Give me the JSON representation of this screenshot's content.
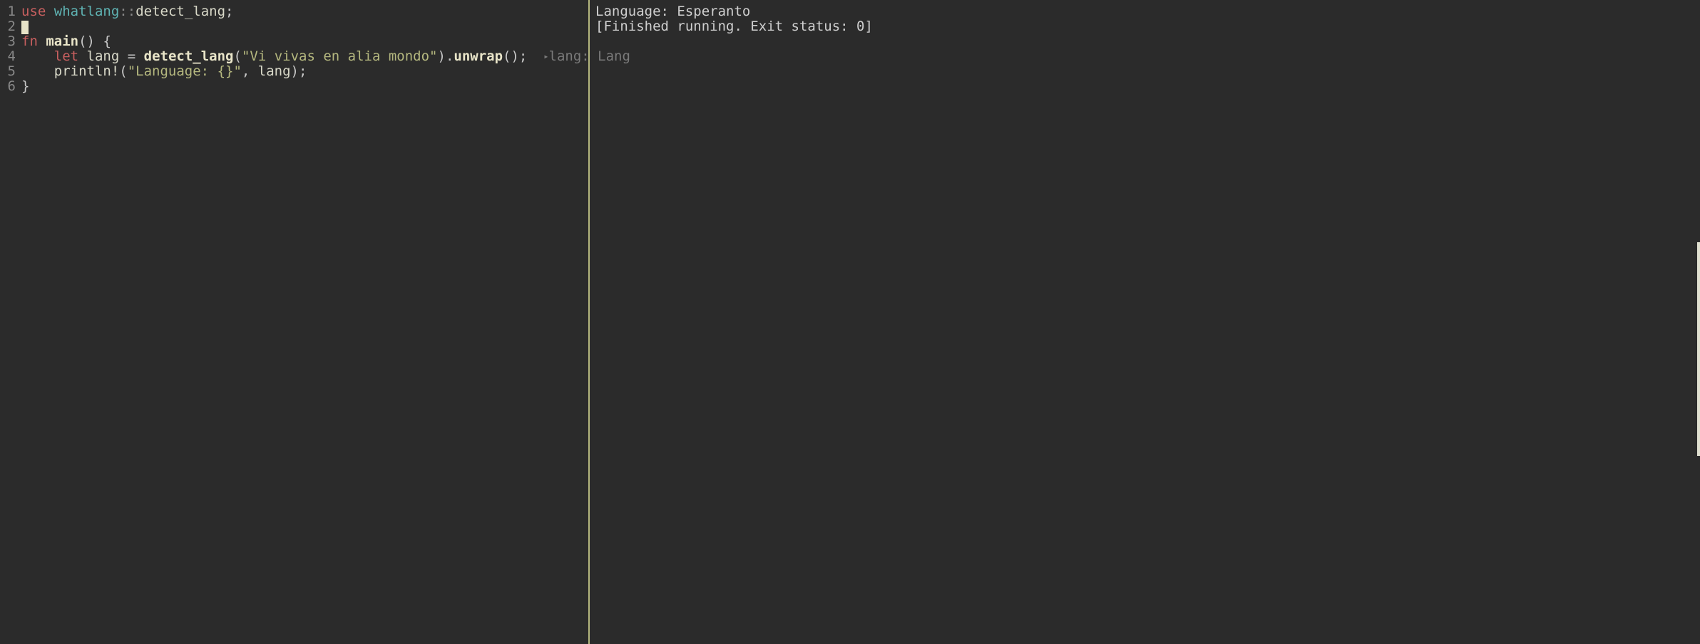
{
  "editor": {
    "gutter": [
      "1",
      "2",
      "3",
      "4",
      "5",
      "6"
    ],
    "line1": {
      "use": "use",
      "crate": "whatlang",
      "sep": "::",
      "item": "detect_lang",
      "semi": ";"
    },
    "line3": {
      "fn": "fn",
      "name": "main",
      "parens": "()",
      "brace": " {"
    },
    "line4": {
      "indent": "    ",
      "let": "let",
      "var": " lang ",
      "eq": "=",
      "sp": " ",
      "call": "detect_lang",
      "open": "(",
      "str": "\"Vi vivas en alia mondo\"",
      "close": ")",
      "dot": ".",
      "unwrap": "unwrap",
      "parens2": "()",
      "semi": ";",
      "hint_gap": "  ",
      "hint_arrow": "▸",
      "hint": "lang: Lang"
    },
    "line5": {
      "indent": "    ",
      "macro": "println!",
      "open": "(",
      "str": "\"Language: {}\"",
      "comma": ", ",
      "arg": "lang",
      "close": ")",
      "semi": ";"
    },
    "line6": {
      "brace": "}"
    }
  },
  "output": {
    "line1": "Language: Esperanto",
    "line2": "[Finished running. Exit status: 0]"
  }
}
